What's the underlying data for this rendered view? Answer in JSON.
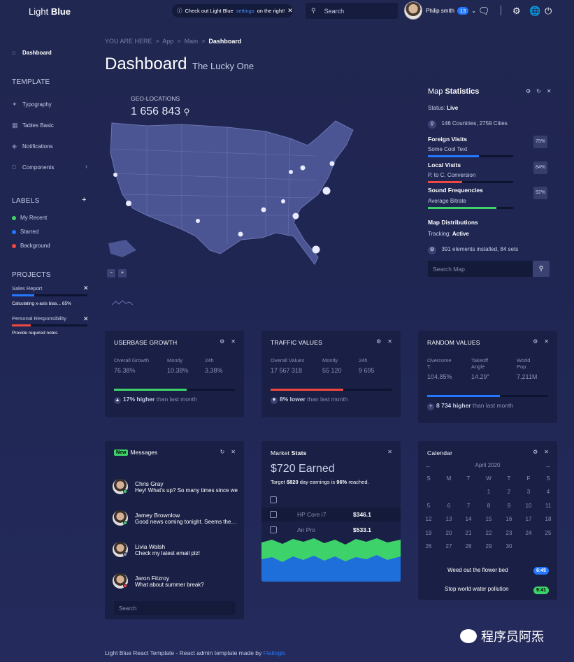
{
  "header": {
    "logo_light": "Light",
    "logo_bold": "Blue",
    "notice_prefix": "Check out Light Blue",
    "notice_link": "settings",
    "notice_suffix": "on the right!",
    "search_placeholder": "Search",
    "user_name": "Philip smith",
    "user_badge": "13"
  },
  "sidebar": {
    "dashboard": "Dashboard",
    "template_heading": "TEMPLATE",
    "items": [
      "Typography",
      "Tables Basic",
      "Notifications",
      "Components"
    ],
    "labels_heading": "LABELS",
    "labels": [
      {
        "name": "My Recent",
        "color": "#3ed36a"
      },
      {
        "name": "Starred",
        "color": "#2477ff"
      },
      {
        "name": "Background",
        "color": "#f0473e"
      }
    ],
    "projects_heading": "PROJECTS",
    "projects": [
      {
        "name": "Sales Report",
        "status": "Calculating x-axis bias... 65%",
        "progress": 0.3,
        "color": "#2477ff"
      },
      {
        "name": "Personal Responsibility",
        "status": "Provide required notes",
        "progress": 0.25,
        "color": "#f0473e"
      }
    ]
  },
  "breadcrumb": {
    "prefix": "YOU ARE HERE",
    "items": [
      "App",
      "Main"
    ],
    "current": "Dashboard"
  },
  "page": {
    "title": "Dashboard",
    "subtitle": "The Lucky One"
  },
  "geo": {
    "label": "GEO-LOCATIONS",
    "value": "1 656 843"
  },
  "map_stats": {
    "title_light": "Map",
    "title_bold": "Statistics",
    "status_label": "Status:",
    "status_value": "Live",
    "countries": "146 Countries, 2759 Cities",
    "rows": [
      {
        "label": "Foreign Visits",
        "sub": "Some Cool Text",
        "pct": "75%",
        "progress": 0.6,
        "color": "#2477ff"
      },
      {
        "label": "Local Visits",
        "sub": "P. to C. Conversion",
        "pct": "84%",
        "progress": 0.4,
        "color": "#f0473e"
      },
      {
        "label": "Sound Frequencies",
        "sub": "Average Bitrate",
        "pct": "92%",
        "progress": 0.8,
        "color": "#3ed36a"
      }
    ],
    "dist_label": "Map Distributions",
    "tracking_label": "Tracking:",
    "tracking_value": "Active",
    "installed": "391 elements installed, 84 sets",
    "search_placeholder": "Search Map"
  },
  "stat_widgets": [
    {
      "title": "USERBASE GROWTH",
      "cols": [
        {
          "h1": "Overall Growth",
          "h2": "",
          "v": "76.38%"
        },
        {
          "h1": "Montly",
          "h2": "",
          "v": "10.38%"
        },
        {
          "h1": "24h",
          "h2": "",
          "v": "3.38%"
        }
      ],
      "progress": 0.6,
      "color": "#3ed36a",
      "foot_bold": "17% higher",
      "foot_rest": "than last month",
      "arrow": "▲"
    },
    {
      "title": "TRAFFIC VALUES",
      "cols": [
        {
          "h1": "Overall Values",
          "h2": "",
          "v": "17 567 318"
        },
        {
          "h1": "Montly",
          "h2": "",
          "v": "55 120"
        },
        {
          "h1": "24h",
          "h2": "",
          "v": "9 695"
        }
      ],
      "progress": 0.6,
      "color": "#f0473e",
      "foot_bold": "8% lower",
      "foot_rest": "than last month",
      "arrow": "▼"
    },
    {
      "title": "RANDOM VALUES",
      "cols": [
        {
          "h1": "Overcome",
          "h2": "T.",
          "v": "104.85%"
        },
        {
          "h1": "Takeoff",
          "h2": "Angle",
          "v": "14.29°"
        },
        {
          "h1": "World",
          "h2": "Pop.",
          "v": "7,211M"
        }
      ],
      "progress": 0.6,
      "color": "#2477ff",
      "foot_bold": "8 734 higher",
      "foot_rest": "than last month",
      "arrow": "+"
    }
  ],
  "messages": {
    "badge": "New",
    "title": "Messages",
    "items": [
      {
        "name": "Chris Gray",
        "text": "Hey! What's up? So many times since we",
        "status": "#3ed36a"
      },
      {
        "name": "Jamey Brownlow",
        "text": "Good news coming tonight. Seems they agreed",
        "status": "#3ed36a"
      },
      {
        "name": "Livia Walsh",
        "text": "Check my latest email plz!",
        "status": "#8a90b4"
      },
      {
        "name": "Jaron Fitzroy",
        "text": "What about summer break?",
        "status": "#f0473e"
      }
    ],
    "search_placeholder": "Search"
  },
  "market": {
    "title_light": "Market",
    "title_bold": "Stats",
    "earned": "$720 Earned",
    "target_prefix": "Target",
    "target_amount": "$820",
    "target_mid": "day earnings is",
    "target_pct": "96%",
    "target_suffix": "reached.",
    "rows": [
      {
        "name": "",
        "value": ""
      },
      {
        "name": "HP Core i7",
        "value": "$346.1"
      },
      {
        "name": "Air Pro",
        "value": "$533.1"
      }
    ]
  },
  "calendar": {
    "title": "Calendar",
    "month": "April 2020",
    "weekdays": [
      "S",
      "M",
      "T",
      "W",
      "T",
      "F",
      "S"
    ],
    "weeks": [
      [
        "",
        "",
        "",
        "1",
        "2",
        "3",
        "4"
      ],
      [
        "5",
        "6",
        "7",
        "8",
        "9",
        "10",
        "11"
      ],
      [
        "12",
        "13",
        "14",
        "15",
        "16",
        "17",
        "18"
      ],
      [
        "19",
        "20",
        "21",
        "22",
        "23",
        "24",
        "25"
      ],
      [
        "26",
        "27",
        "28",
        "29",
        "30",
        "",
        ""
      ]
    ],
    "events": [
      {
        "text": "Weed out the flower bed",
        "time": "6:45",
        "color": "#2477ff"
      },
      {
        "text": "Stop world water pollution",
        "time": "9:41",
        "color": "#3ed36a"
      }
    ]
  },
  "footer": {
    "text": "Light Blue React Template - React admin template made by",
    "link": "Flatlogic"
  },
  "watermark": "程序员阿炁"
}
